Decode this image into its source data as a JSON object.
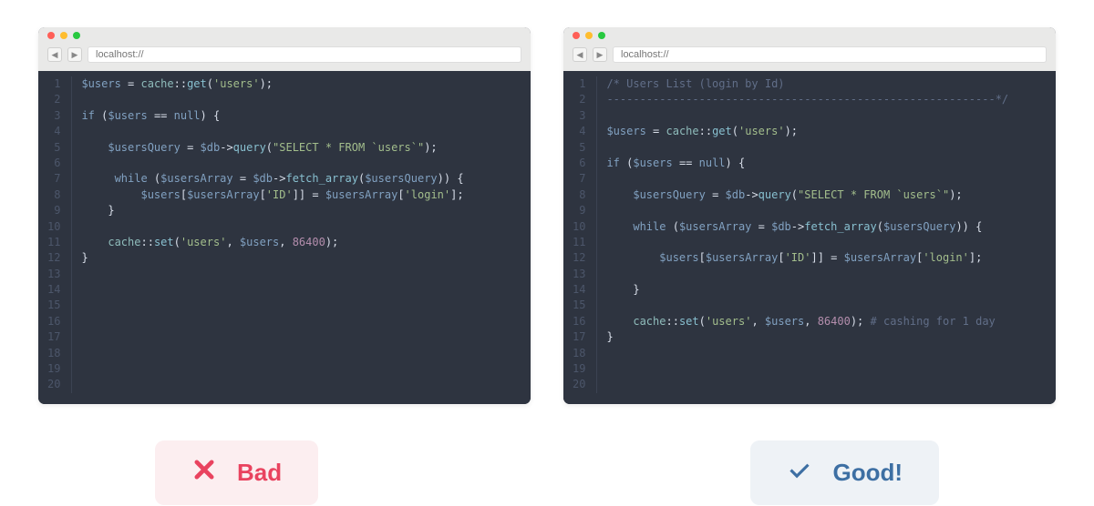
{
  "addressbar": "localhost://",
  "bad_label": "Bad",
  "good_label": "Good!",
  "line_count": 20,
  "code_bad": [
    {
      "t": [
        [
          "v",
          "$users"
        ],
        [
          "pn",
          " = "
        ],
        [
          "cls",
          "cache"
        ],
        [
          "pn",
          "::"
        ],
        [
          "fn",
          "get"
        ],
        [
          "pn",
          "("
        ],
        [
          "str",
          "'users'"
        ],
        [
          "pn",
          ");"
        ]
      ]
    },
    {
      "t": []
    },
    {
      "t": [
        [
          "kw",
          "if"
        ],
        [
          "pn",
          " ("
        ],
        [
          "v",
          "$users"
        ],
        [
          "pn",
          " == "
        ],
        [
          "kw",
          "null"
        ],
        [
          "pn",
          ") {"
        ]
      ]
    },
    {
      "t": []
    },
    {
      "t": [
        [
          "pn",
          "    "
        ],
        [
          "v",
          "$usersQuery"
        ],
        [
          "pn",
          " = "
        ],
        [
          "v",
          "$db"
        ],
        [
          "pn",
          "->"
        ],
        [
          "fn",
          "query"
        ],
        [
          "pn",
          "("
        ],
        [
          "str",
          "\"SELECT * FROM `users`\""
        ],
        [
          "pn",
          ");"
        ]
      ]
    },
    {
      "t": []
    },
    {
      "t": [
        [
          "pn",
          "     "
        ],
        [
          "kw",
          "while"
        ],
        [
          "pn",
          " ("
        ],
        [
          "v",
          "$usersArray"
        ],
        [
          "pn",
          " = "
        ],
        [
          "v",
          "$db"
        ],
        [
          "pn",
          "->"
        ],
        [
          "fn",
          "fetch_array"
        ],
        [
          "pn",
          "("
        ],
        [
          "v",
          "$usersQuery"
        ],
        [
          "pn",
          ")) {"
        ]
      ]
    },
    {
      "t": [
        [
          "pn",
          "         "
        ],
        [
          "v",
          "$users"
        ],
        [
          "pn",
          "["
        ],
        [
          "v",
          "$usersArray"
        ],
        [
          "pn",
          "["
        ],
        [
          "str",
          "'ID'"
        ],
        [
          "pn",
          "]] = "
        ],
        [
          "v",
          "$usersArray"
        ],
        [
          "pn",
          "["
        ],
        [
          "str",
          "'login'"
        ],
        [
          "pn",
          "];"
        ]
      ]
    },
    {
      "t": [
        [
          "pn",
          "    }"
        ]
      ]
    },
    {
      "t": []
    },
    {
      "t": [
        [
          "pn",
          "    "
        ],
        [
          "cls",
          "cache"
        ],
        [
          "pn",
          "::"
        ],
        [
          "fn",
          "set"
        ],
        [
          "pn",
          "("
        ],
        [
          "str",
          "'users'"
        ],
        [
          "pn",
          ", "
        ],
        [
          "v",
          "$users"
        ],
        [
          "pn",
          ", "
        ],
        [
          "num",
          "86400"
        ],
        [
          "pn",
          ");"
        ]
      ]
    },
    {
      "t": [
        [
          "pn",
          "}"
        ]
      ]
    },
    {
      "t": []
    },
    {
      "t": []
    },
    {
      "t": []
    },
    {
      "t": []
    },
    {
      "t": []
    },
    {
      "t": []
    },
    {
      "t": []
    },
    {
      "t": []
    }
  ],
  "code_good": [
    {
      "t": [
        [
          "cm",
          "/* Users List (login by Id)"
        ]
      ]
    },
    {
      "t": [
        [
          "cm",
          "-----------------------------------------------------------*/"
        ]
      ]
    },
    {
      "t": []
    },
    {
      "t": [
        [
          "v",
          "$users"
        ],
        [
          "pn",
          " = "
        ],
        [
          "cls",
          "cache"
        ],
        [
          "pn",
          "::"
        ],
        [
          "fn",
          "get"
        ],
        [
          "pn",
          "("
        ],
        [
          "str",
          "'users'"
        ],
        [
          "pn",
          ");"
        ]
      ]
    },
    {
      "t": []
    },
    {
      "t": [
        [
          "kw",
          "if"
        ],
        [
          "pn",
          " ("
        ],
        [
          "v",
          "$users"
        ],
        [
          "pn",
          " == "
        ],
        [
          "kw",
          "null"
        ],
        [
          "pn",
          ") {"
        ]
      ]
    },
    {
      "t": []
    },
    {
      "t": [
        [
          "pn",
          "    "
        ],
        [
          "v",
          "$usersQuery"
        ],
        [
          "pn",
          " = "
        ],
        [
          "v",
          "$db"
        ],
        [
          "pn",
          "->"
        ],
        [
          "fn",
          "query"
        ],
        [
          "pn",
          "("
        ],
        [
          "str",
          "\"SELECT * FROM `users`\""
        ],
        [
          "pn",
          ");"
        ]
      ]
    },
    {
      "t": []
    },
    {
      "t": [
        [
          "pn",
          "    "
        ],
        [
          "kw",
          "while"
        ],
        [
          "pn",
          " ("
        ],
        [
          "v",
          "$usersArray"
        ],
        [
          "pn",
          " = "
        ],
        [
          "v",
          "$db"
        ],
        [
          "pn",
          "->"
        ],
        [
          "fn",
          "fetch_array"
        ],
        [
          "pn",
          "("
        ],
        [
          "v",
          "$usersQuery"
        ],
        [
          "pn",
          ")) {"
        ]
      ]
    },
    {
      "t": []
    },
    {
      "t": [
        [
          "pn",
          "        "
        ],
        [
          "v",
          "$users"
        ],
        [
          "pn",
          "["
        ],
        [
          "v",
          "$usersArray"
        ],
        [
          "pn",
          "["
        ],
        [
          "str",
          "'ID'"
        ],
        [
          "pn",
          "]] = "
        ],
        [
          "v",
          "$usersArray"
        ],
        [
          "pn",
          "["
        ],
        [
          "str",
          "'login'"
        ],
        [
          "pn",
          "];"
        ]
      ]
    },
    {
      "t": []
    },
    {
      "t": [
        [
          "pn",
          "    }"
        ]
      ]
    },
    {
      "t": []
    },
    {
      "t": [
        [
          "pn",
          "    "
        ],
        [
          "cls",
          "cache"
        ],
        [
          "pn",
          "::"
        ],
        [
          "fn",
          "set"
        ],
        [
          "pn",
          "("
        ],
        [
          "str",
          "'users'"
        ],
        [
          "pn",
          ", "
        ],
        [
          "v",
          "$users"
        ],
        [
          "pn",
          ", "
        ],
        [
          "num",
          "86400"
        ],
        [
          "pn",
          "); "
        ],
        [
          "cm",
          "# cashing for 1 day"
        ]
      ]
    },
    {
      "t": [
        [
          "pn",
          "}"
        ]
      ]
    },
    {
      "t": []
    },
    {
      "t": []
    },
    {
      "t": []
    }
  ]
}
